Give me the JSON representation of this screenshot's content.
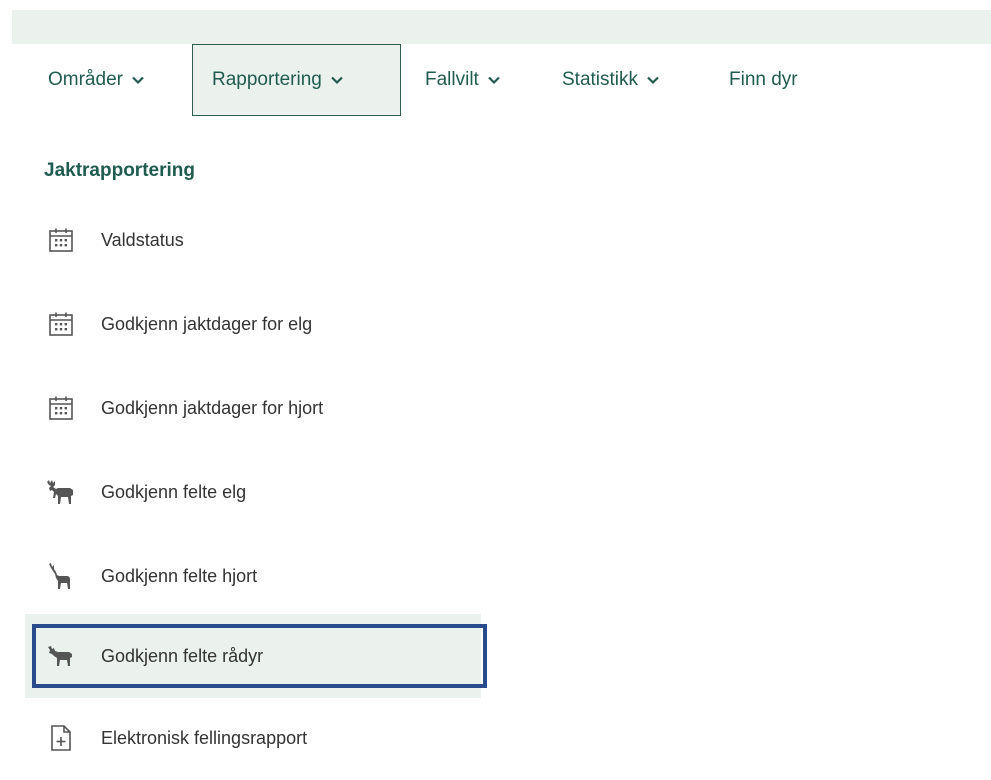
{
  "nav": {
    "items": [
      {
        "label": "Områder",
        "has_dropdown": true
      },
      {
        "label": "Rapportering",
        "has_dropdown": true,
        "active": true
      },
      {
        "label": "Fallvilt",
        "has_dropdown": true
      },
      {
        "label": "Statistikk",
        "has_dropdown": true
      },
      {
        "label": "Finn dyr",
        "has_dropdown": false
      }
    ]
  },
  "section": {
    "title": "Jaktrapportering"
  },
  "menu": {
    "items": [
      {
        "label": "Valdstatus",
        "icon": "calendar-icon"
      },
      {
        "label": "Godkjenn jaktdager for elg",
        "icon": "calendar-icon"
      },
      {
        "label": "Godkjenn jaktdager for hjort",
        "icon": "calendar-icon"
      },
      {
        "label": "Godkjenn felte elg",
        "icon": "moose-icon"
      },
      {
        "label": "Godkjenn felte hjort",
        "icon": "deer-icon"
      },
      {
        "label": "Godkjenn felte rådyr",
        "icon": "roe-deer-icon",
        "selected": true
      },
      {
        "label": "Elektronisk fellingsrapport",
        "icon": "document-add-icon"
      }
    ]
  },
  "colors": {
    "accent": "#1f5c4f",
    "active_bg": "#ebf2ee",
    "highlight": "#2b4c8c"
  }
}
